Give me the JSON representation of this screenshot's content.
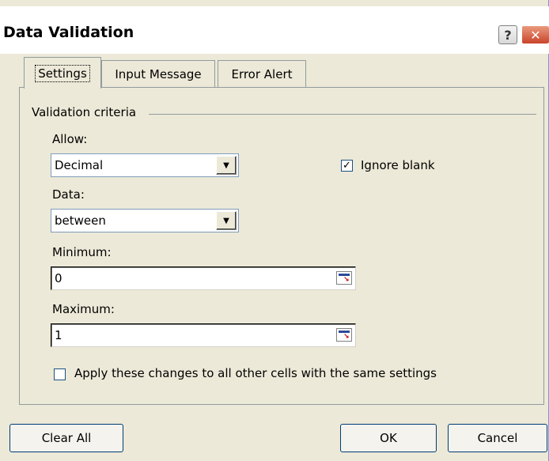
{
  "dialog": {
    "title": "Data Validation",
    "help_glyph": "?",
    "close_glyph": "✕"
  },
  "tabs": [
    {
      "label": "Settings",
      "selected": true
    },
    {
      "label": "Input Message",
      "selected": false
    },
    {
      "label": "Error Alert",
      "selected": false
    }
  ],
  "criteria": {
    "group_label": "Validation criteria",
    "allow_label": "Allow:",
    "allow_value": "Decimal",
    "data_label": "Data:",
    "data_value": "between",
    "minimum_label": "Minimum:",
    "minimum_value": "0",
    "maximum_label": "Maximum:",
    "maximum_value": "1",
    "ignore_blank_label": "Ignore blank",
    "ignore_blank_checked": true,
    "apply_all_label": "Apply these changes to all other cells with the same settings",
    "apply_all_checked": false
  },
  "buttons": {
    "clear_all": "Clear All",
    "ok": "OK",
    "cancel": "Cancel"
  },
  "colors": {
    "dialog_bg": "#ece9d8",
    "close_red": "#c9442a",
    "ref_arrow": "#c00000"
  }
}
